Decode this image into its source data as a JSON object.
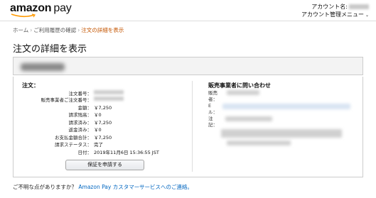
{
  "header": {
    "logo_brand": "amazon",
    "logo_product": "pay",
    "account_label": "アカウント名:",
    "account_menu_label": "アカウント管理メニュー",
    "caret": "⌄"
  },
  "breadcrumb": {
    "home": "ホーム",
    "history": "ご利用履歴の確認",
    "current": "注文の詳細を表示",
    "separator": "›"
  },
  "page_title": "注文の詳細を表示",
  "order": {
    "heading": "注文：",
    "rows": [
      {
        "label": "注文番号：",
        "value": ""
      },
      {
        "label": "販売事業者ご注文番号：",
        "value": ""
      },
      {
        "label": "金額：",
        "value": "￥7,250"
      },
      {
        "label": "請求残高：",
        "value": "￥0"
      },
      {
        "label": "請求済み：",
        "value": "￥7,250"
      },
      {
        "label": "返金済み：",
        "value": "￥0"
      },
      {
        "label": "お支払金額合計：",
        "value": "￥7,250"
      },
      {
        "label": "請求ステータス：",
        "value": "完了"
      },
      {
        "label": "日付：",
        "value": "2019年11月6日 15:36:55 JST"
      }
    ],
    "guarantee_button": "保証を申請する"
  },
  "contact": {
    "heading": "販売事業者に問い合わせ",
    "labels": [
      "販売",
      "者：",
      "E",
      "ル：",
      "注",
      "記："
    ]
  },
  "footer": {
    "question": "ご不明な点がありますか？",
    "link": "Amazon Pay カスタマーサービスへのご連絡。"
  },
  "colors": {
    "accent_link": "#0066c0",
    "breadcrumb_active": "#c45500",
    "smile": "#f90"
  }
}
